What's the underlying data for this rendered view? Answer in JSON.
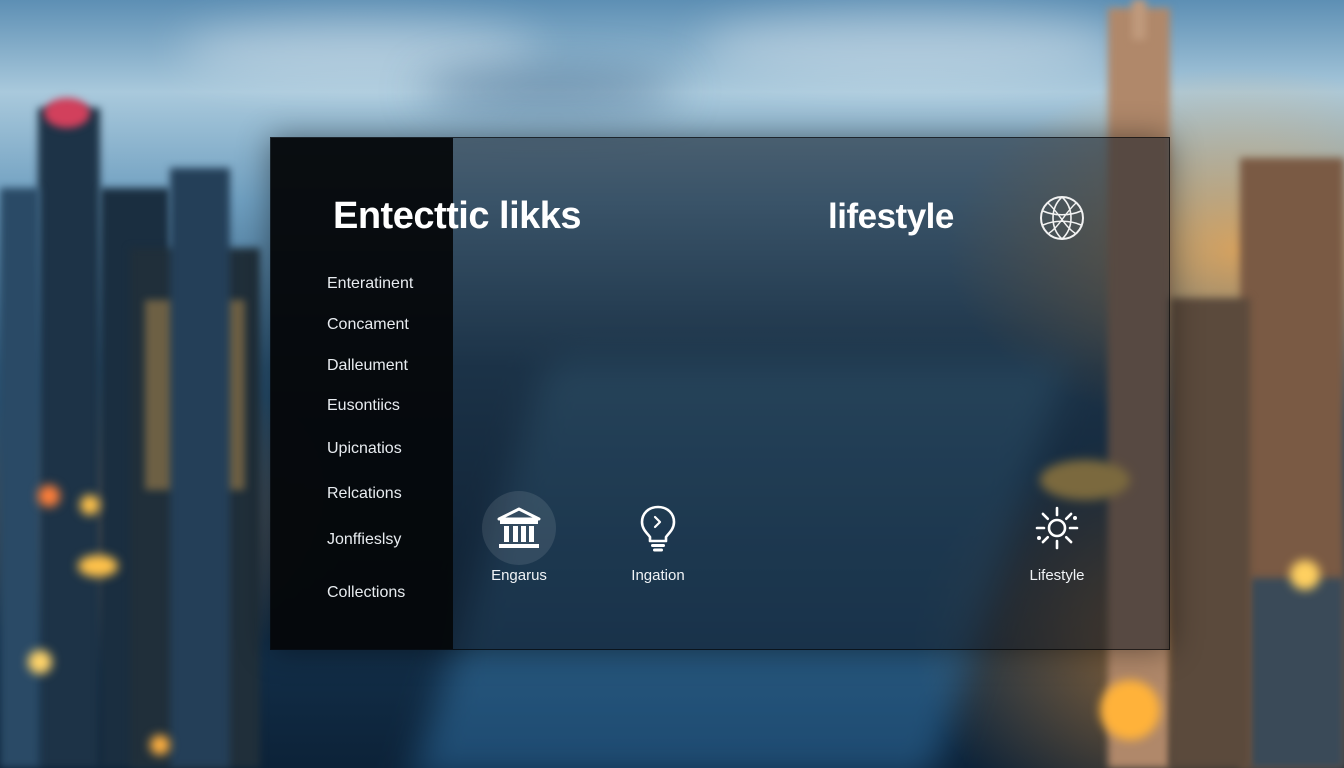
{
  "header": {
    "title": "Entecttic likks",
    "section_title": "lifestyle"
  },
  "sidebar": {
    "items": [
      {
        "label": "Enteratinent"
      },
      {
        "label": "Concament"
      },
      {
        "label": "Dalleument"
      },
      {
        "label": "Eusontiics"
      },
      {
        "label": "Upicnatios"
      },
      {
        "label": "Relcations"
      },
      {
        "label": "Jonffieslsy"
      },
      {
        "label": "Collections"
      }
    ]
  },
  "tiles": [
    {
      "label": "Engarus",
      "icon": "bank-icon"
    },
    {
      "label": "Ingation",
      "icon": "lightbulb-icon"
    },
    {
      "label": "Lifestyle",
      "icon": "sun-icon"
    }
  ],
  "icons": {
    "header_button": "globe-icon"
  },
  "colors": {
    "panel": "#0e1620",
    "sidebar": "#040609",
    "text": "#ffffff",
    "sky": "#6f9fc0",
    "city_glow": "#ffaa46"
  }
}
